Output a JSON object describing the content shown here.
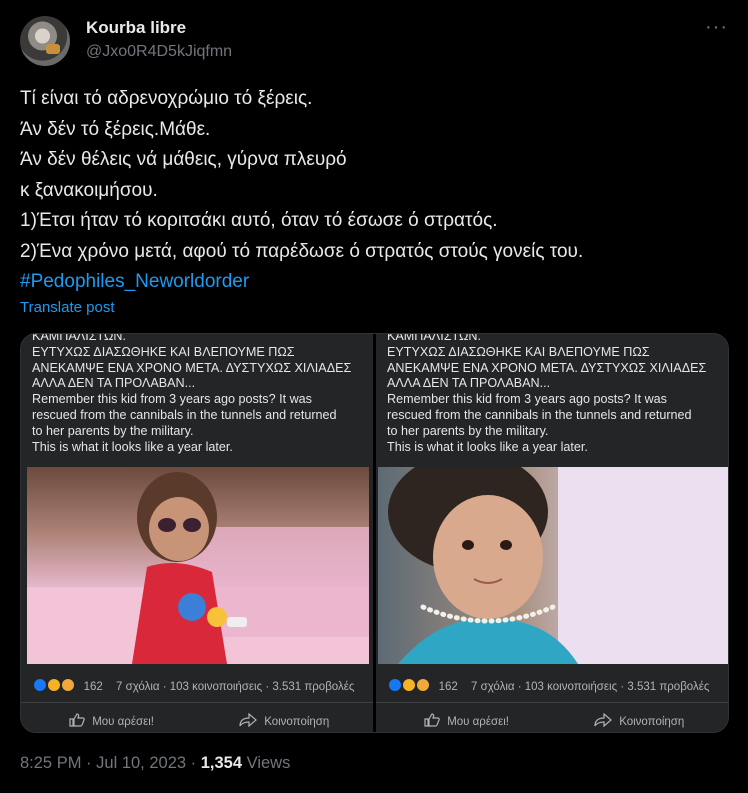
{
  "author": {
    "display_name": "Kourba libre",
    "handle": "@Jxo0R4D5kJiqfmn",
    "more_label": "···"
  },
  "tweet": {
    "lines": [
      "Τί είναι τό αδρενοχρώμιο τό ξέρεις.",
      "Άν δέν τό ξέρεις.Μάθε.",
      "Άν δέν θέλεις νά μάθεις, γύρνα πλευρό",
      "κ ξανακοιμήσου.",
      "1)Έτσι ήταν τό κοριτσάκι αυτό, όταν τό έσωσε ό στρατός.",
      "2)Ένα χρόνο μετά, αφού τό παρέδωσε ό στρατός στούς γονείς του."
    ],
    "hashtag": "#Pedophiles_Neworldorder",
    "translate_label": "Translate post"
  },
  "media": {
    "panels": [
      {
        "text_lines": [
          "ΚΑΜΠΑΛΙΣΤΩΝ.",
          "ΕΥΤΥΧΩΣ ΔΙΑΣΩΘΗΚΕ ΚΑΙ ΒΛΕΠΟΥΜΕ ΠΩΣ",
          "ΑΝΕΚΑΜΨΕ ΕΝΑ ΧΡΟΝΟ ΜΕΤΑ. ΔΥΣΤΥΧΩΣ ΧΙΛΙΑΔΕΣ",
          "ΑΛΛΑ ΔΕΝ ΤΑ ΠΡΟΛΑΒΑΝ...",
          "Remember this kid from 3 years ago posts? It was",
          "rescued from the cannibals in the tunnels and returned",
          "to her parents by the military.",
          "This is what it looks like a year later."
        ],
        "reaction_count": "162",
        "stats": "7 σχόλια · 103 κοινοποιήσεις · 3.531 προβολές",
        "like_label": "Μου αρέσει!",
        "share_label": "Κοινοποίηση"
      },
      {
        "text_lines": [
          "ΚΑΜΠΑΛΙΣΤΩΝ.",
          "ΕΥΤΥΧΩΣ ΔΙΑΣΩΘΗΚΕ ΚΑΙ ΒΛΕΠΟΥΜΕ ΠΩΣ",
          "ΑΝΕΚΑΜΨΕ ΕΝΑ ΧΡΟΝΟ ΜΕΤΑ. ΔΥΣΤΥΧΩΣ ΧΙΛΙΑΔΕΣ",
          "ΑΛΛΑ ΔΕΝ ΤΑ ΠΡΟΛΑΒΑΝ...",
          "Remember this kid from 3 years ago posts? It was",
          "rescued from the cannibals in the tunnels and returned",
          "to her parents by the military.",
          "This is what it looks like a year later."
        ],
        "reaction_count": "162",
        "stats": "7 σχόλια · 103 κοινοποιήσεις · 3.531 προβολές",
        "like_label": "Μου αρέσει!",
        "share_label": "Κοινοποίηση"
      }
    ],
    "reaction_colors": {
      "like": "#1877f2",
      "haha": "#f7b125",
      "care": "#f0a83c"
    }
  },
  "footer": {
    "time": "8:25 PM",
    "date": "Jul 10, 2023",
    "views_count": "1,354",
    "views_label": "Views",
    "separator": "·"
  }
}
